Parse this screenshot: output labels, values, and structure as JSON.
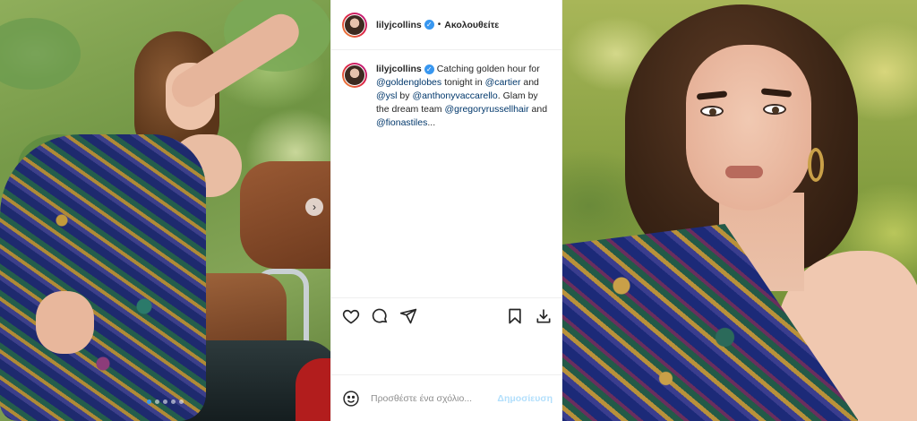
{
  "post": {
    "username": "lilyjcollins",
    "separator": "•",
    "follow_label": "Ακολουθείτε",
    "carousel": {
      "total": 5,
      "active_index": 0
    }
  },
  "caption": {
    "username": "lilyjcollins",
    "t1": "Catching golden hour for",
    "m1": "@goldenglobes",
    "t2": "tonight in",
    "m2": "@cartier",
    "t3": "and",
    "m3": "@ysl",
    "t4": "by",
    "m4": "@anthonyvaccarello",
    "t5": ".",
    "t6": "Glam by the dream team",
    "m5": "@gregoryrussellhair",
    "t7": "and",
    "m6": "@fionastiles",
    "t8": "..."
  },
  "actions": {
    "icons": [
      "heart-icon",
      "comment-icon",
      "share-icon",
      "bookmark-icon",
      "download-icon"
    ]
  },
  "comment_box": {
    "placeholder": "Προσθέστε ένα σχόλιο...",
    "post_label": "Δημοσίευση"
  },
  "colors": {
    "accent": "#3897f0",
    "mention": "#00376b",
    "post_disabled": "#b2dffc"
  }
}
